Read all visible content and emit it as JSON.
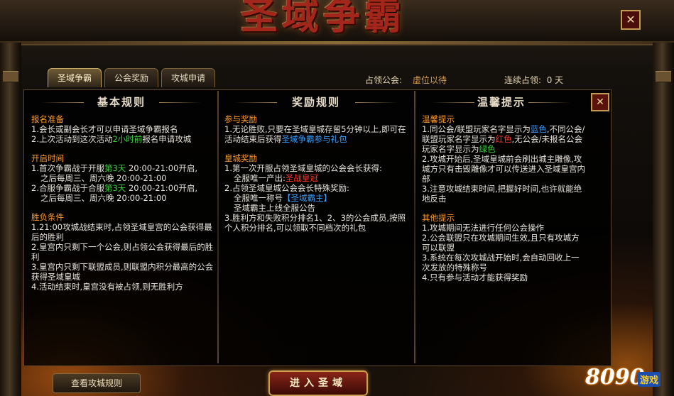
{
  "window": {
    "title": "圣域争霸",
    "close_icon": "close-icon"
  },
  "tabs": [
    {
      "label": "圣域争霸",
      "active": true
    },
    {
      "label": "公会奖励",
      "active": false
    },
    {
      "label": "攻城申请",
      "active": false
    }
  ],
  "status": {
    "guild_label": "占领公会:",
    "guild_value": "虚位以待",
    "streak_label": "连续占领:",
    "streak_value": "0 天"
  },
  "col1": {
    "title": "基本规则",
    "s1_title": "报名准备",
    "s1_l1": "1.会长或副会长才可以申请圣域争霸报名",
    "s1_l2a": "2.上次活动到这次活动",
    "s1_l2b": "2小时前",
    "s1_l2c": "报名申请攻城",
    "s2_title": "开启时间",
    "s2_l1a": "1.首次争霸战于开服",
    "s2_l1b": "第3天",
    "s2_l1c": " 20:00-21:00开启,",
    "s2_l1d": "之后每周三、周六晚 20:00-21:00",
    "s2_l2a": "2.合服争霸战于合服",
    "s2_l2b": "第3天",
    "s2_l2c": " 20:00-21:00开启,",
    "s2_l2d": "之后每周三、周六晚 20:00-21:00",
    "s3_title": "胜负条件",
    "s3_l1": "1.21:00攻城战结束时,占领圣域皇宫的公会获得最后的胜利",
    "s3_l2": "2.皇宫内只剩下一个公会,则占领公会获得最后的胜利",
    "s3_l3": "3.皇宫内只剩下联盟成员,则联盟内积分最高的公会获得圣域皇城",
    "s3_l4": "4.活动结束时,皇宫没有被占领,则无胜利方"
  },
  "col2": {
    "title": "奖励规则",
    "s1_title": "参与奖励",
    "s1_l1a": "1.无论胜败,只要在圣域皇城存留5分钟以上,即可在活动结束后获得",
    "s1_l1b": "圣域争霸参与礼包",
    "s2_title": "皇城奖励",
    "s2_l1": "1.第一次开服占领圣域皇城的公会会长获得:",
    "s2_l1b": "全服唯一产出:",
    "s2_l1c": "圣战皇冠",
    "s2_l2": "2.占领圣域皇城公会会长特殊奖励:",
    "s2_l2b": "全服唯一称号",
    "s2_l2c": "【圣域霸主】",
    "s2_l2d": "圣域霸主上线全服公告",
    "s2_l3": "3.胜利方和失败积分排名1、2、3的公会成员,按照个人积分排名,可以领取不同档次的礼包"
  },
  "col3": {
    "title": "温馨提示",
    "s1_title": "温馨提示",
    "s1_l1a": "1.同公会/联盟玩家名字显示为",
    "s1_l1b": "蓝色",
    "s1_l1c": ",不同公会/联盟玩家名字显示为",
    "s1_l1d": "红色",
    "s1_l1e": ",无公会/未报名公会玩家名字显示为",
    "s1_l1f": "绿色",
    "s1_l2": "2.攻城开始后,圣域皇城前会刷出城主雕像,攻城方只有击毁雕像才可以传送进入圣域皇宫内部",
    "s1_l3": "3.注意攻城结束时间,把握好时间,也许就能绝地反击",
    "s2_title": "其他提示",
    "s2_l1": "1.攻城期间无法进行任何公会操作",
    "s2_l2": "2.公会联盟只在攻城期间生效,且只有攻城方可以联盟",
    "s2_l3": "3.系统在每次攻城战开始时,会自动回收上一次发放的特殊称号",
    "s2_l4": "4.只有参与活动才能获得奖励"
  },
  "buttons": {
    "view_rules": "查看攻城规则",
    "enter": "进入圣域"
  },
  "logo": {
    "num": "8090",
    "text": "游戏"
  },
  "colors": {
    "accent_orange": "#ff9a2a",
    "green": "#3cd33c",
    "red": "#ff3a2a",
    "blue": "#3aa0ff"
  }
}
